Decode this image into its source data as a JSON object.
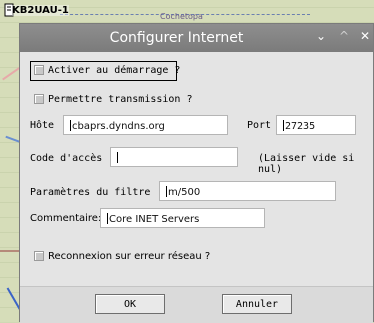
{
  "app": {
    "tag_label": "KB2UAU-1"
  },
  "map": {
    "label": "Cochetopa"
  },
  "window": {
    "title": "Configurer Internet",
    "controls": {
      "minimize": "⌄",
      "maximize": "^",
      "close": "✕"
    }
  },
  "form": {
    "activate_on_startup": {
      "label": "Activer au démarrage ?",
      "checked": false
    },
    "allow_transmission": {
      "label": "Permettre transmission ?",
      "checked": false
    },
    "host": {
      "label": "Hôte",
      "value": "cbaprs.dyndns.org"
    },
    "port": {
      "label": "Port",
      "value": "27235"
    },
    "access_code": {
      "label": "Code d'accès",
      "value": "",
      "hint": "(Laisser vide si nul)"
    },
    "filter_params": {
      "label": "Paramètres du filtre",
      "value": "m/500"
    },
    "comment": {
      "label": "Commentaire:",
      "value": "Core INET Servers"
    },
    "reconnect": {
      "label": "Reconnexion sur erreur réseau ?",
      "checked": false
    }
  },
  "buttons": {
    "ok": "OK",
    "cancel": "Annuler"
  }
}
